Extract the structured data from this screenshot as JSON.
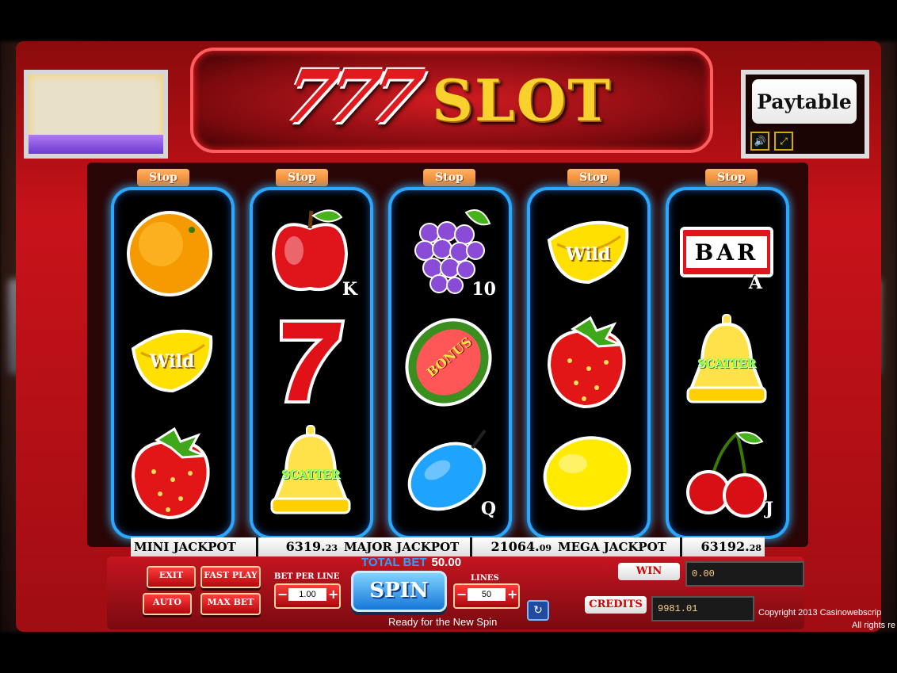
{
  "title": {
    "logo_number": "777",
    "logo_word": "SLOT"
  },
  "paytable_label": "Paytable",
  "stop_label": "Stop",
  "reels": [
    {
      "symbols": [
        {
          "name": "orange",
          "letter": ""
        },
        {
          "name": "banana-wild",
          "label": "Wild",
          "letter": ""
        },
        {
          "name": "strawberry",
          "letter": ""
        }
      ]
    },
    {
      "symbols": [
        {
          "name": "apple",
          "letter": "K"
        },
        {
          "name": "seven",
          "letter": ""
        },
        {
          "name": "bell-scatter",
          "label": "SCATTER",
          "letter": ""
        }
      ]
    },
    {
      "symbols": [
        {
          "name": "grapes",
          "letter": "10"
        },
        {
          "name": "watermelon-bonus",
          "label": "BONUS",
          "letter": ""
        },
        {
          "name": "plum",
          "letter": "Q"
        }
      ]
    },
    {
      "symbols": [
        {
          "name": "banana-wild",
          "label": "Wild",
          "letter": ""
        },
        {
          "name": "strawberry",
          "letter": ""
        },
        {
          "name": "lemon",
          "letter": ""
        }
      ]
    },
    {
      "symbols": [
        {
          "name": "bar",
          "label": "BAR",
          "letter": "A"
        },
        {
          "name": "bell-scatter",
          "label": "SCATTER",
          "letter": ""
        },
        {
          "name": "cherries",
          "letter": "J"
        }
      ]
    }
  ],
  "jackpots": [
    {
      "label": "MINI JACKPOT",
      "main": "6319.",
      "cents": "23"
    },
    {
      "label": "MAJOR JACKPOT",
      "main": "21064.",
      "cents": "09"
    },
    {
      "label": "MEGA JACKPOT",
      "main": "63192.",
      "cents": "28"
    }
  ],
  "controls": {
    "total_bet_label": "TOTAL BET",
    "total_bet_value": "50.00",
    "exit": "EXIT",
    "fast_play": "FAST PLAY",
    "auto": "AUTO",
    "max_bet": "MAX BET",
    "bet_per_line_label": "BET PER LINE",
    "bet_per_line_value": "1.00",
    "spin": "SPIN",
    "lines_label": "LINES",
    "lines_value": "50",
    "status": "Ready for the New Spin",
    "win_label": "WIN",
    "win_value": "0.00",
    "credits_label": "CREDITS",
    "credits_value": "9981.01"
  },
  "copyright_line1": "Copyright 2013 Casinowebscrip",
  "copyright_line2": "All rights re",
  "colors": {
    "cabinet_red": "#c8121a",
    "reel_border": "#2ba7ff",
    "logo_gold": "#f8d12c",
    "stop_orange": "#f07a1c"
  }
}
